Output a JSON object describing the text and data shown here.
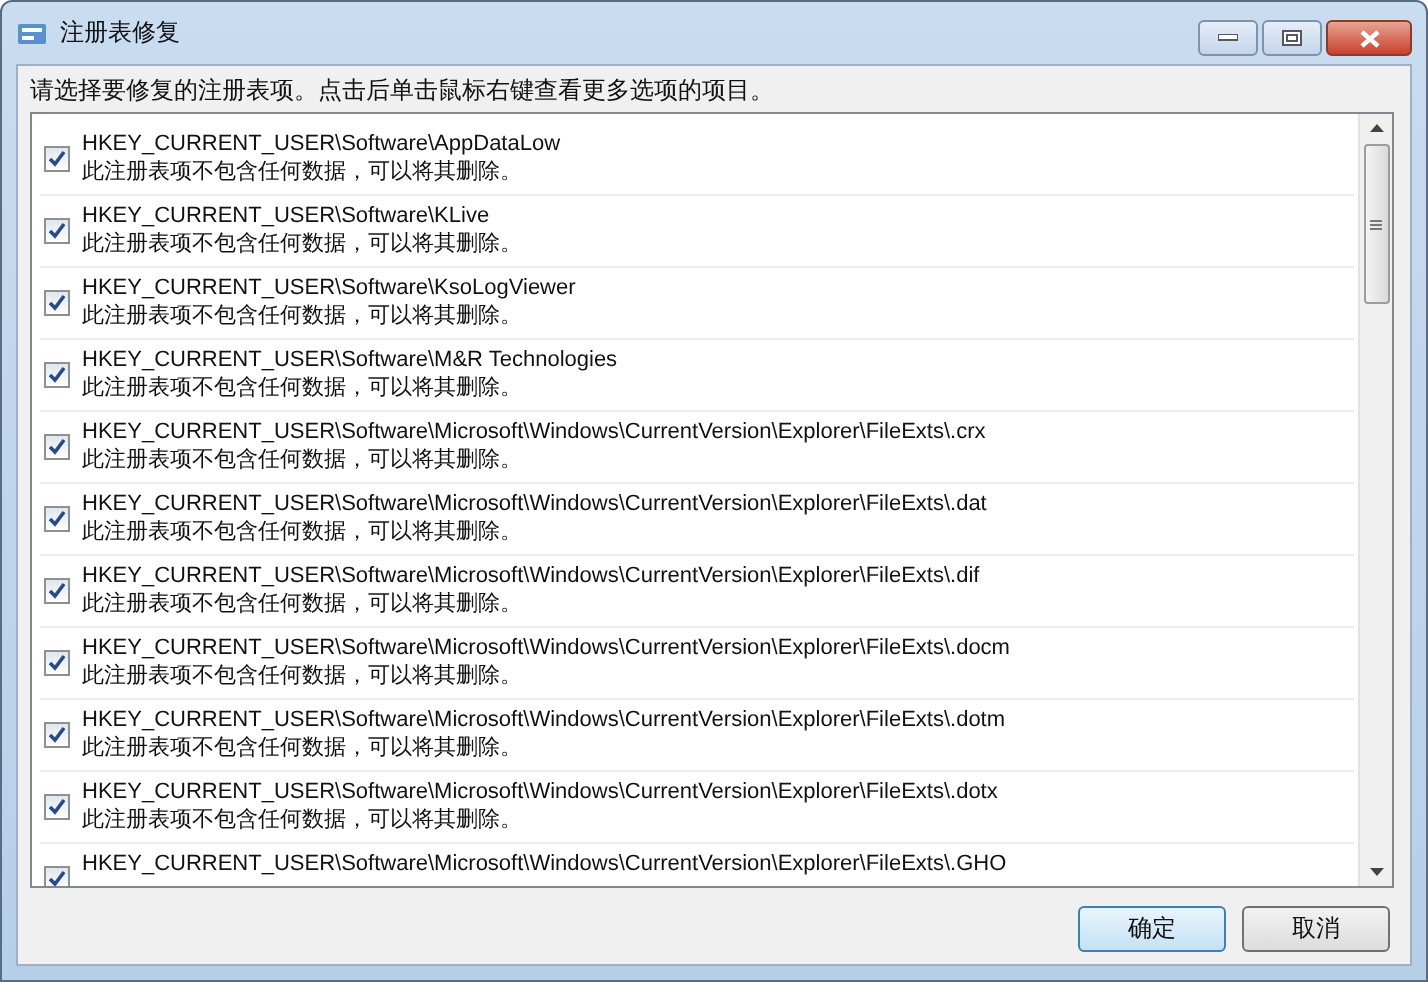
{
  "window": {
    "title": "注册表修复"
  },
  "instruction": "请选择要修复的注册表项。点击后单击鼠标右键查看更多选项的项目。",
  "items": [
    {
      "path": "HKEY_CURRENT_USER\\Software\\AppDataLow",
      "note": "此注册表项不包含任何数据，可以将其删除。",
      "checked": true
    },
    {
      "path": "HKEY_CURRENT_USER\\Software\\KLive",
      "note": "此注册表项不包含任何数据，可以将其删除。",
      "checked": true
    },
    {
      "path": "HKEY_CURRENT_USER\\Software\\KsoLogViewer",
      "note": "此注册表项不包含任何数据，可以将其删除。",
      "checked": true
    },
    {
      "path": "HKEY_CURRENT_USER\\Software\\M&R Technologies",
      "note": "此注册表项不包含任何数据，可以将其删除。",
      "checked": true
    },
    {
      "path": "HKEY_CURRENT_USER\\Software\\Microsoft\\Windows\\CurrentVersion\\Explorer\\FileExts\\.crx",
      "note": "此注册表项不包含任何数据，可以将其删除。",
      "checked": true
    },
    {
      "path": "HKEY_CURRENT_USER\\Software\\Microsoft\\Windows\\CurrentVersion\\Explorer\\FileExts\\.dat",
      "note": "此注册表项不包含任何数据，可以将其删除。",
      "checked": true
    },
    {
      "path": "HKEY_CURRENT_USER\\Software\\Microsoft\\Windows\\CurrentVersion\\Explorer\\FileExts\\.dif",
      "note": "此注册表项不包含任何数据，可以将其删除。",
      "checked": true
    },
    {
      "path": "HKEY_CURRENT_USER\\Software\\Microsoft\\Windows\\CurrentVersion\\Explorer\\FileExts\\.docm",
      "note": "此注册表项不包含任何数据，可以将其删除。",
      "checked": true
    },
    {
      "path": "HKEY_CURRENT_USER\\Software\\Microsoft\\Windows\\CurrentVersion\\Explorer\\FileExts\\.dotm",
      "note": "此注册表项不包含任何数据，可以将其删除。",
      "checked": true
    },
    {
      "path": "HKEY_CURRENT_USER\\Software\\Microsoft\\Windows\\CurrentVersion\\Explorer\\FileExts\\.dotx",
      "note": "此注册表项不包含任何数据，可以将其删除。",
      "checked": true
    },
    {
      "path": "HKEY_CURRENT_USER\\Software\\Microsoft\\Windows\\CurrentVersion\\Explorer\\FileExts\\.GHO",
      "checked": true
    }
  ],
  "buttons": [
    {
      "label": "确定",
      "default": true
    },
    {
      "label": "取消",
      "default": false
    }
  ]
}
